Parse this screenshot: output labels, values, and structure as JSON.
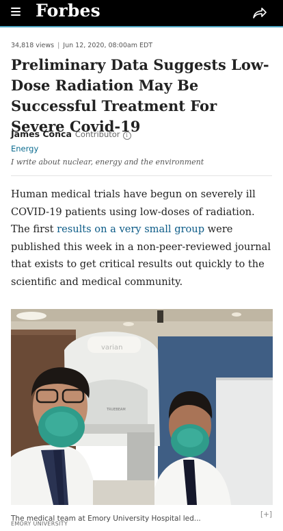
{
  "header": {
    "logo": "Forbes",
    "icons": {
      "menu": "hamburger-menu-icon",
      "share": "share-arrow-icon"
    },
    "colors": {
      "bar": "#000000",
      "accent_line": "#4ea6c4"
    }
  },
  "article": {
    "views": "34,818 views",
    "separator": "|",
    "date": "Jun 12, 2020, 08:00am EDT",
    "headline": "Preliminary Data Suggests Low-Dose Radiation May Be Successful Treatment For Severe Covid-19",
    "author": {
      "name": "James Conca",
      "role": "Contributor",
      "info_icon": "i",
      "channel": "Energy",
      "tagline": "I write about nuclear, energy and the environment"
    },
    "body": {
      "before_link": "Human medical trials have begun on severely ill COVID-19 patients using low-doses of radiation. The first ",
      "link_text": "results on a very small group",
      "after_link": " were published this week in a non-peer-reviewed journal that exists to get critical results out quickly to the scientific and medical community."
    },
    "image": {
      "caption": "The medical team at Emory University Hospital led...",
      "expand_label": "[+]",
      "credit": "EMORY UNIVERSITY",
      "machine_brand": "varian",
      "machine_model": "TRUEBEAM"
    }
  }
}
